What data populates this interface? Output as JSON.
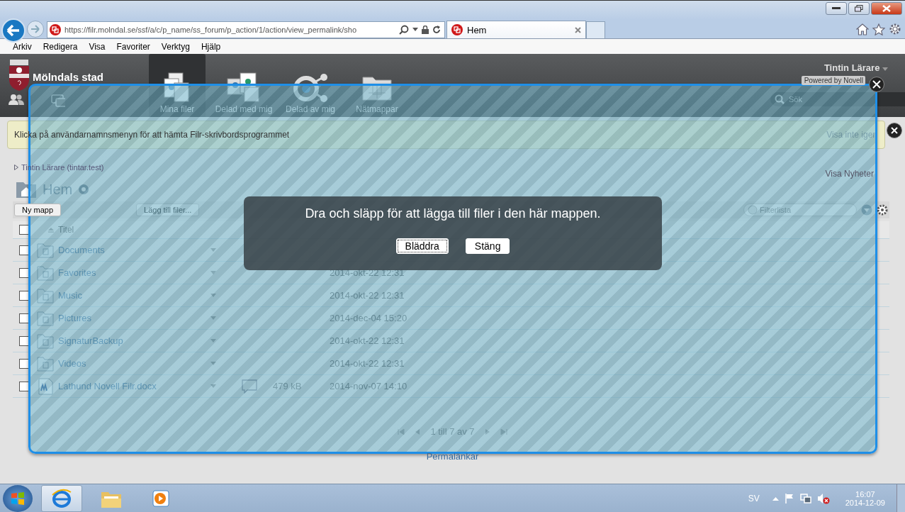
{
  "browser": {
    "address": "https://filr.molndal.se/ssf/a/c/p_name/ss_forum/p_action/1/action/view_permalink/sho",
    "tabs": [
      {
        "title": "Hem",
        "selected": true
      }
    ],
    "menu": [
      "Arkiv",
      "Redigera",
      "Visa",
      "Favoriter",
      "Verktyg",
      "Hjälp"
    ]
  },
  "header": {
    "site": "Mölndals stad",
    "nav": [
      {
        "label": "Mina filer",
        "kind": "files",
        "selected": true
      },
      {
        "label": "Delad med mig",
        "kind": "shared-with",
        "selected": false
      },
      {
        "label": "Delad av mig",
        "kind": "shared-by",
        "selected": false
      },
      {
        "label": "Nätmappar",
        "kind": "net",
        "selected": false
      }
    ],
    "user": "Tintin Lärare",
    "powered": "Powered by Novell",
    "search": "Sök"
  },
  "notice": {
    "text": "Klicka på användarnamnsmenyn för att hämta Filr-skrivbordsprogrammet",
    "dismiss": "Visa inte igen"
  },
  "breadcrumb": "Tintin Lärare (tintar.test)",
  "news_link": "Visa Nyheter",
  "folder_title": "Hem",
  "toolbar": [
    "Ny mapp",
    "Lägg till filer..."
  ],
  "filter": {
    "placeholder": "Filterlista"
  },
  "table": {
    "columns": [
      "Titel"
    ],
    "all_checked": false,
    "rows": [
      {
        "kind": "folder",
        "name": "Documents",
        "checked": false
      },
      {
        "kind": "folder",
        "name": "Favorites",
        "checked": false,
        "date": "2014-okt-22 12:31"
      },
      {
        "kind": "folder",
        "name": "Music",
        "checked": false,
        "date": "2014-okt-22 12:31"
      },
      {
        "kind": "folder",
        "name": "Pictures",
        "checked": false,
        "date": "2014-dec-04 15:20"
      },
      {
        "kind": "folder",
        "name": "SignaturBackup",
        "checked": false,
        "date": "2014-okt-22 12:31"
      },
      {
        "kind": "folder",
        "name": "Videos",
        "checked": false,
        "date": "2014-okt-22 12:31"
      },
      {
        "kind": "document",
        "name": "Lathund Novell Filr.docx",
        "checked": false,
        "size": "479 kB",
        "date": "2014-nov-07 14:10"
      }
    ]
  },
  "pagination": "1 till 7 av 7",
  "permalink": "Permalänkar",
  "dialog": {
    "message": "Dra och släpp för att lägga till filer i den här mappen.",
    "buttons": [
      {
        "label": "Bläddra",
        "focused": true
      },
      {
        "label": "Stäng",
        "focused": false
      }
    ]
  },
  "taskbar": {
    "apps": [
      {
        "kind": "browser",
        "selected": true
      },
      {
        "kind": "folders",
        "selected": false
      },
      {
        "kind": "media",
        "selected": false
      }
    ],
    "language": "SV",
    "time": "16:07",
    "date": "2014-12-09"
  }
}
